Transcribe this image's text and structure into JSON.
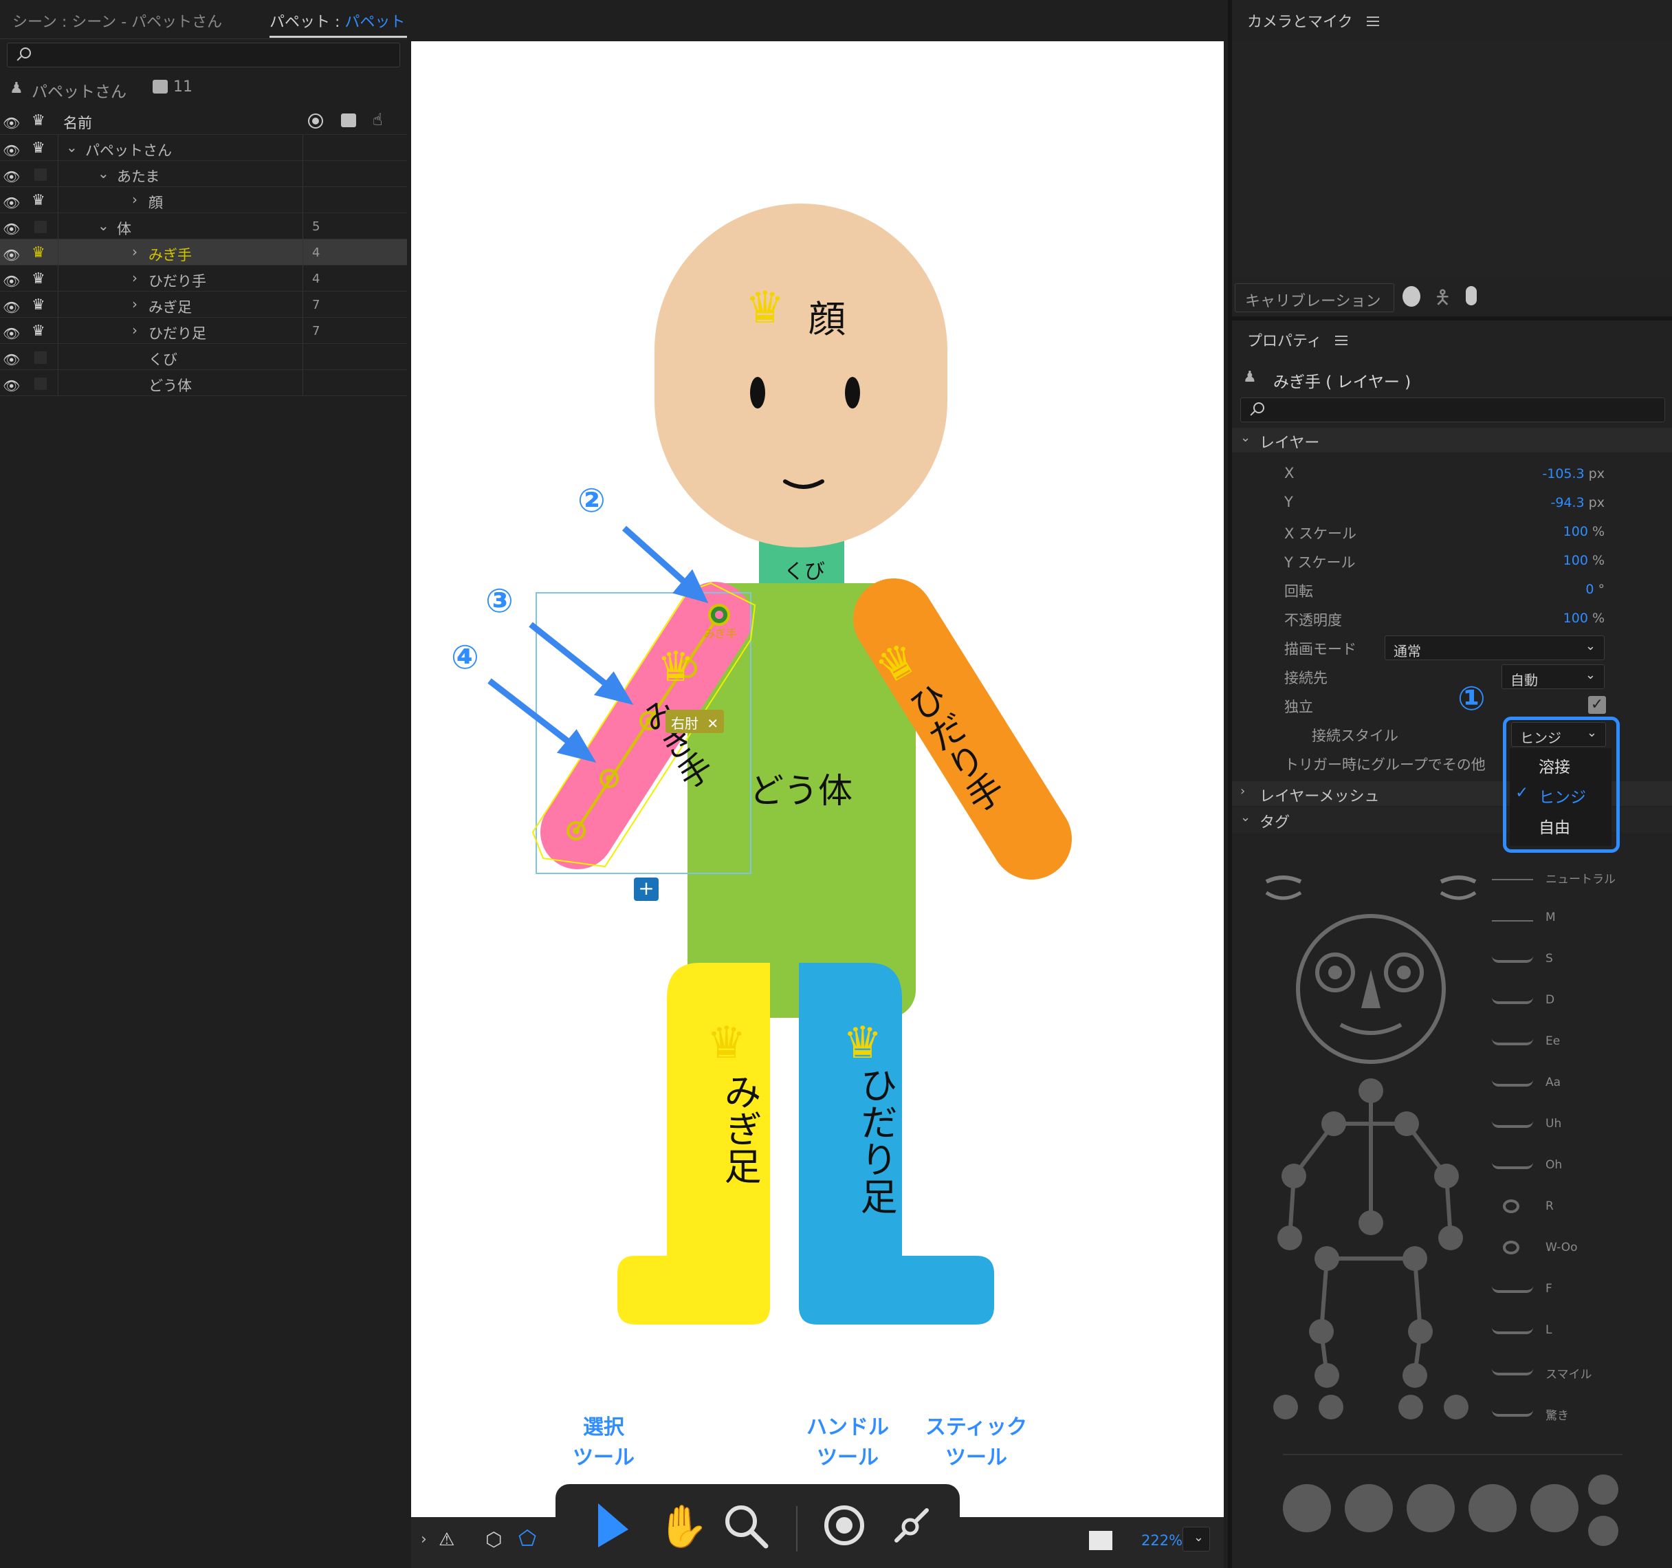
{
  "colors": {
    "bg": "#1e1e1e",
    "panel": "#232323",
    "accent": "#2f8dff",
    "canvas": "#ffffff",
    "head": "#f0ccA6",
    "neck": "#49c28a",
    "body": "#8dc63f",
    "right_arm": "#ff79a8",
    "left_arm": "#f7941d",
    "right_leg": "#ffec1a",
    "left_leg": "#29abe2",
    "highlight": "#d4c400"
  },
  "scene_tab": {
    "label": "シーン : シーン - パペットさん"
  },
  "puppet_tab": {
    "prefix": "パペット : ",
    "name": "パペットさん"
  },
  "camera_tab": {
    "label": "カメラとマイク"
  },
  "puppet_panel": {
    "puppet_name": "パペットさん",
    "count": "11",
    "col_name": "名前",
    "search_placeholder": ""
  },
  "layers": [
    {
      "name": "パペットさん",
      "count": "",
      "indent": 0,
      "open": true,
      "crown": true,
      "selected": false,
      "caret": "open"
    },
    {
      "name": "あたま",
      "count": "",
      "indent": 1,
      "open": true,
      "crown": false,
      "selected": false,
      "caret": "open"
    },
    {
      "name": "顔",
      "count": "",
      "indent": 2,
      "open": false,
      "crown": true,
      "selected": false,
      "caret": "closed"
    },
    {
      "name": "体",
      "count": "5",
      "indent": 1,
      "open": true,
      "crown": false,
      "selected": false,
      "caret": "open"
    },
    {
      "name": "みぎ手",
      "count": "4",
      "indent": 2,
      "open": false,
      "crown": true,
      "selected": true,
      "caret": "closed"
    },
    {
      "name": "ひだり手",
      "count": "4",
      "indent": 2,
      "open": false,
      "crown": true,
      "selected": false,
      "caret": "closed"
    },
    {
      "name": "みぎ足",
      "count": "7",
      "indent": 2,
      "open": false,
      "crown": true,
      "selected": false,
      "caret": "closed"
    },
    {
      "name": "ひだり足",
      "count": "7",
      "indent": 2,
      "open": false,
      "crown": true,
      "selected": false,
      "caret": "closed"
    },
    {
      "name": "くび",
      "count": "",
      "indent": 2,
      "open": false,
      "crown": false,
      "selected": false,
      "caret": "none"
    },
    {
      "name": "どう体",
      "count": "",
      "indent": 2,
      "open": false,
      "crown": false,
      "selected": false,
      "caret": "none"
    }
  ],
  "canvas": {
    "head_label": "顔",
    "neck_label": "くび",
    "body_label": "どう体",
    "right_arm_label": "みぎ手",
    "left_arm_label": "ひだり手",
    "right_leg_label": "みぎ足",
    "left_leg_label": "ひだり足",
    "handle_tag": "みぎ手",
    "elbow_tag": "右肘",
    "elbow_close": "✕",
    "plus": "+"
  },
  "annotations": {
    "num2": "②",
    "num3": "③",
    "num4": "④",
    "num1": "①",
    "select_tool": [
      "選択",
      "ツール"
    ],
    "handle_tool": [
      "ハンドル",
      "ツール"
    ],
    "stick_tool": [
      "スティック",
      "ツール"
    ]
  },
  "status_bar": {
    "zoom": "222%"
  },
  "calibration": {
    "label": "キャリブレーション"
  },
  "properties": {
    "title": "プロパティ",
    "layer_title": "みぎ手 ( レイヤー )",
    "section_layer": "レイヤー",
    "fields": [
      {
        "label": "X",
        "value": "-105.3",
        "unit": " px"
      },
      {
        "label": "Y",
        "value": "-94.3",
        "unit": " px"
      },
      {
        "label": "X スケール",
        "value": "100",
        "unit": " %"
      },
      {
        "label": "Y スケール",
        "value": "100",
        "unit": " %"
      },
      {
        "label": "回転",
        "value": "0",
        "unit": " °"
      },
      {
        "label": "不透明度",
        "value": "100",
        "unit": " %"
      }
    ],
    "blend_label": "描画モード",
    "blend_value": "通常",
    "attach_label": "接続先",
    "attach_value": "自動",
    "independent_label": "独立",
    "attach_style_label": "接続スタイル",
    "attach_style_value": "ヒンジ",
    "trigger_label": "トリガー時にグループでその他を",
    "dropdown_options": [
      "溶接",
      "ヒンジ",
      "自由"
    ],
    "dropdown_selected": "ヒンジ",
    "section_mesh": "レイヤーメッシュ",
    "section_tags": "タグ"
  },
  "visemes": [
    "ニュートラル",
    "M",
    "S",
    "D",
    "Ee",
    "Aa",
    "Uh",
    "Oh",
    "R",
    "W-Oo",
    "F",
    "L",
    "スマイル",
    "驚き"
  ]
}
